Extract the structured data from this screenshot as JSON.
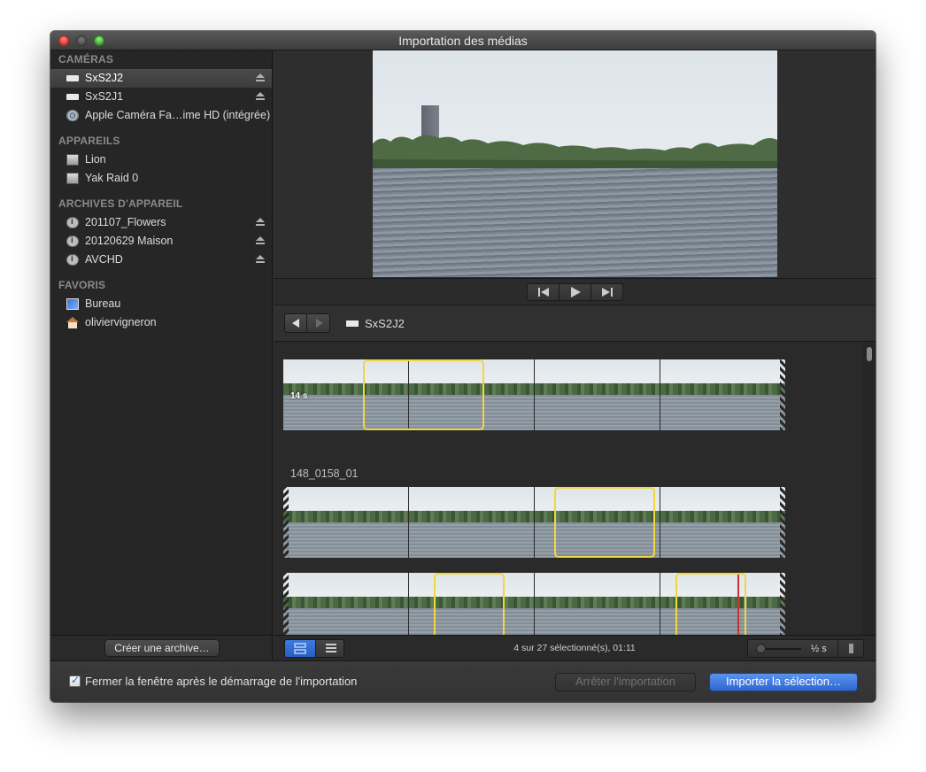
{
  "window": {
    "title": "Importation des médias"
  },
  "sidebar": {
    "sections": [
      {
        "title": "CAMÉRAS",
        "items": [
          {
            "label": "SxS2J2",
            "icon": "memory-card-icon",
            "eject": true,
            "selected": true
          },
          {
            "label": "SxS2J1",
            "icon": "memory-card-icon",
            "eject": true,
            "selected": false
          },
          {
            "label": "Apple Caméra Fa…ime HD (intégrée)",
            "icon": "facetime-camera-icon",
            "eject": false,
            "selected": false
          }
        ]
      },
      {
        "title": "APPAREILS",
        "items": [
          {
            "label": "Lion",
            "icon": "hard-disk-icon",
            "eject": false
          },
          {
            "label": "Yak Raid 0",
            "icon": "hard-disk-icon",
            "eject": false
          }
        ]
      },
      {
        "title": "ARCHIVES D'APPAREIL",
        "items": [
          {
            "label": "201107_Flowers",
            "icon": "archive-icon",
            "eject": true
          },
          {
            "label": "20120629 Maison",
            "icon": "archive-icon",
            "eject": true
          },
          {
            "label": "AVCHD",
            "icon": "archive-icon",
            "eject": true
          }
        ]
      },
      {
        "title": "FAVORIS",
        "items": [
          {
            "label": "Bureau",
            "icon": "desktop-folder-icon",
            "eject": false
          },
          {
            "label": "oliviervigneron",
            "icon": "home-folder-icon",
            "eject": false
          }
        ]
      }
    ],
    "create_archive_label": "Créer une archive…"
  },
  "path": {
    "current": "SxS2J2"
  },
  "browser": {
    "clip_name": "148_0158_01",
    "clip_duration": "14 s",
    "status": "4 sur 27 sélectionné(s), 01:11",
    "zoom_label": "½ s"
  },
  "bottom": {
    "close_after_import_label": "Fermer la fenêtre après le démarrage de l'importation",
    "close_after_import_checked": true,
    "stop_import_label": "Arrêter l'importation",
    "import_selection_label": "Importer la sélection…"
  },
  "colors": {
    "selection": "#f2d640",
    "primary_button": "#3a76e0",
    "playhead": "#c8322f"
  }
}
